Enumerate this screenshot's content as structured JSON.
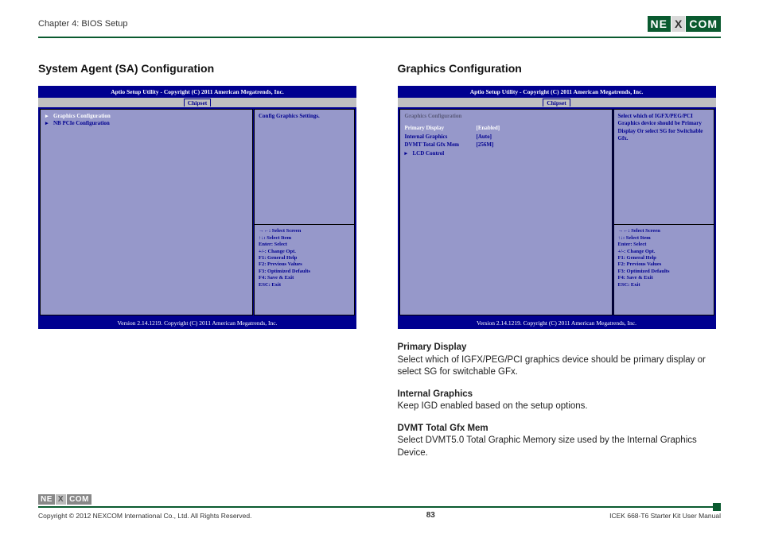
{
  "header": {
    "chapter": "Chapter 4: BIOS Setup",
    "logo_ne": "NE",
    "logo_x": "X",
    "logo_com": "COM"
  },
  "left": {
    "title": "System Agent (SA) Configuration",
    "bios_header": "Aptio Setup Utility - Copyright (C) 2011 American Megatrends, Inc.",
    "tab": "Chipset",
    "menu_items": [
      {
        "arrow": "▸",
        "label": "Graphics Configuration",
        "selected": true
      },
      {
        "arrow": "▸",
        "label": "NB PCIe Configuration",
        "selected": false
      }
    ],
    "help_top": "Config Graphics Settings.",
    "help_bot": [
      "→←: Select Screen",
      "↑↓: Select Item",
      "Enter: Select",
      "+/-: Change Opt.",
      "F1: General Help",
      "F2: Previous Values",
      "F3: Optimized Defaults",
      "F4: Save & Exit",
      "ESC: Exit"
    ],
    "bios_footer": "Version 2.14.1219. Copyright (C) 2011 American Megatrends, Inc."
  },
  "right": {
    "title": "Graphics Configuration",
    "bios_header": "Aptio Setup Utility - Copyright (C) 2011 American Megatrends, Inc.",
    "tab": "Chipset",
    "section_head": "Graphics Configuration",
    "rows": [
      {
        "label": "Primary Display",
        "value": "[Enabled]",
        "selected": true
      },
      {
        "label": "Internal Graphics",
        "value": "[Auto]",
        "selected": false
      },
      {
        "label": "DVMT Total Gfx Mem",
        "value": "[256M]",
        "selected": false
      }
    ],
    "submenu": {
      "arrow": "▸",
      "label": "LCD Control"
    },
    "help_top": "Select which of IGFX/PEG/PCI Graphics device should be Primary Display Or select SG for Switchable Gfx.",
    "help_bot": [
      "→←: Select Screen",
      "↑↓: Select Item",
      "Enter: Select",
      "+/-: Change Opt.",
      "F1: General Help",
      "F2: Previous Values",
      "F3: Optimized Defaults",
      "F4: Save & Exit",
      "ESC: Exit"
    ],
    "bios_footer": "Version 2.14.1219. Copyright (C) 2011 American Megatrends, Inc.",
    "desc": {
      "h1": "Primary Display",
      "p1": "Select which of IGFX/PEG/PCI graphics device should be primary display or select SG for switchable GFx.",
      "h2": "Internal Graphics",
      "p2": "Keep IGD enabled based on the setup options.",
      "h3": "DVMT Total Gfx Mem",
      "p3": "Select DVMT5.0 Total Graphic Memory size used by the Internal Graphics Device."
    }
  },
  "footer": {
    "logo_ne": "NE",
    "logo_x": "X",
    "logo_com": "COM",
    "copyright_left": "Copyright © 2012 NEXCOM International Co., Ltd. All Rights Reserved.",
    "page": "83",
    "copyright_right": "ICEK 668-T6 Starter Kit User Manual"
  }
}
